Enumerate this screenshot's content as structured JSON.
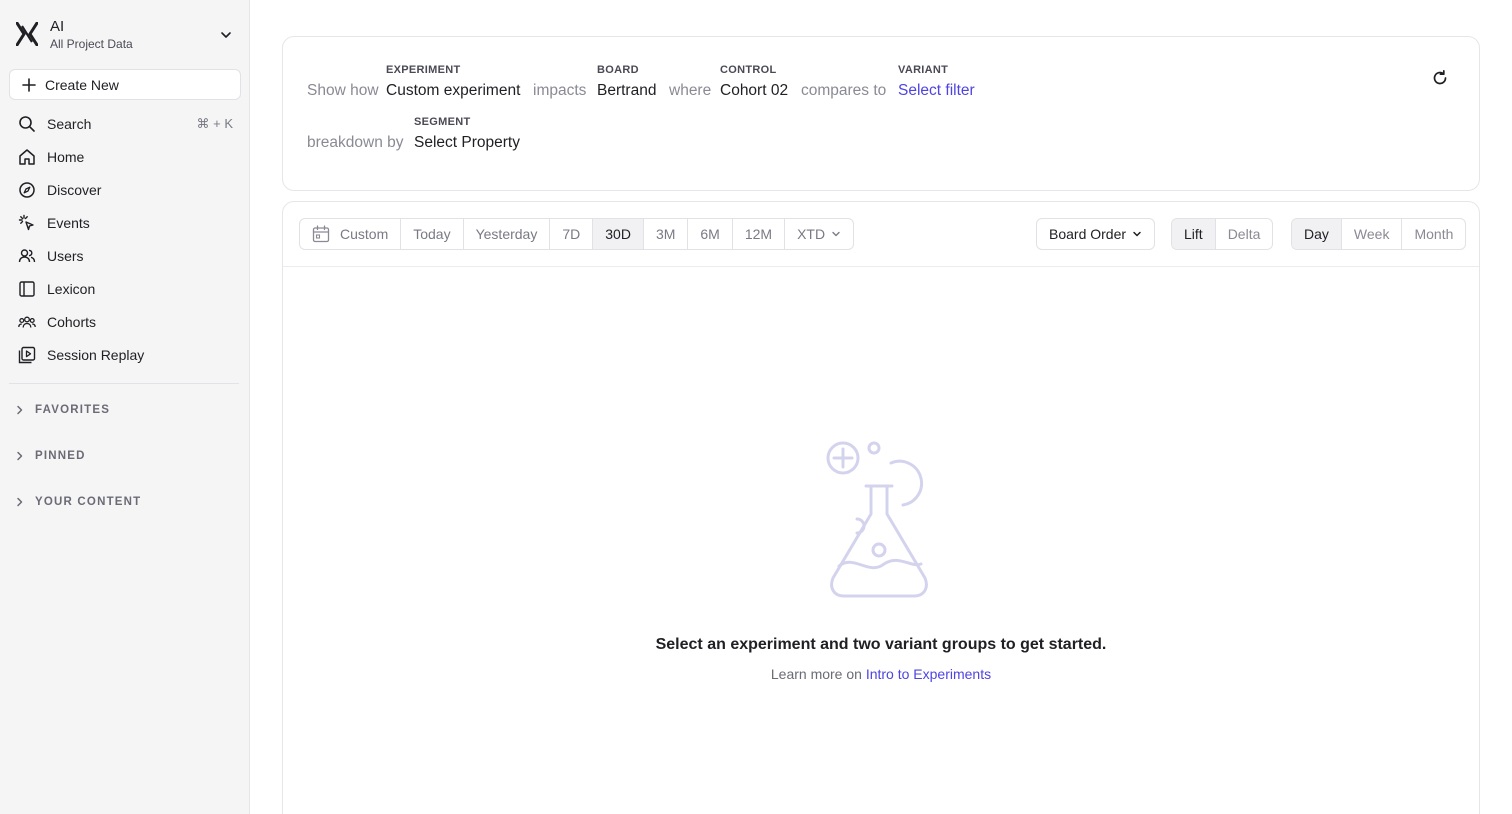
{
  "project": {
    "name": "AI",
    "subtitle": "All Project Data"
  },
  "sidebar": {
    "create_label": "Create New",
    "search": {
      "label": "Search",
      "shortcut": "⌘ + K"
    },
    "items": [
      {
        "label": "Home",
        "icon": "home-icon"
      },
      {
        "label": "Discover",
        "icon": "compass-icon"
      },
      {
        "label": "Events",
        "icon": "cursor-click-icon"
      },
      {
        "label": "Users",
        "icon": "users-icon"
      },
      {
        "label": "Lexicon",
        "icon": "book-icon"
      },
      {
        "label": "Cohorts",
        "icon": "group-icon"
      },
      {
        "label": "Session Replay",
        "icon": "play-square-icon"
      }
    ],
    "sections": [
      "FAVORITES",
      "PINNED",
      "YOUR CONTENT"
    ]
  },
  "query": {
    "show_how": "Show how",
    "experiment_caption": "EXPERIMENT",
    "experiment_value": "Custom experiment",
    "impacts": "impacts",
    "board_caption": "BOARD",
    "board_value": "Bertrand",
    "where": "where",
    "control_caption": "CONTROL",
    "control_value": "Cohort 02",
    "compares_to": "compares to",
    "variant_caption": "VARIANT",
    "variant_value": "Select filter",
    "breakdown_by": "breakdown by",
    "segment_caption": "SEGMENT",
    "segment_value": "Select Property"
  },
  "toolbar": {
    "date_ranges": [
      "Custom",
      "Today",
      "Yesterday",
      "7D",
      "30D",
      "3M",
      "6M",
      "12M",
      "XTD"
    ],
    "active_date_range": "30D",
    "board_order": "Board Order",
    "mode": [
      "Lift",
      "Delta"
    ],
    "active_mode": "Lift",
    "granularity": [
      "Day",
      "Week",
      "Month"
    ],
    "active_granularity": "Day"
  },
  "empty_state": {
    "title": "Select an experiment and two variant groups to get started.",
    "sub_prefix": "Learn more on",
    "link": "Intro to Experiments"
  },
  "colors": {
    "accent": "#4f44e0",
    "sidebar_bg": "#f5f5f6",
    "illustration": "#d4d3ee"
  }
}
